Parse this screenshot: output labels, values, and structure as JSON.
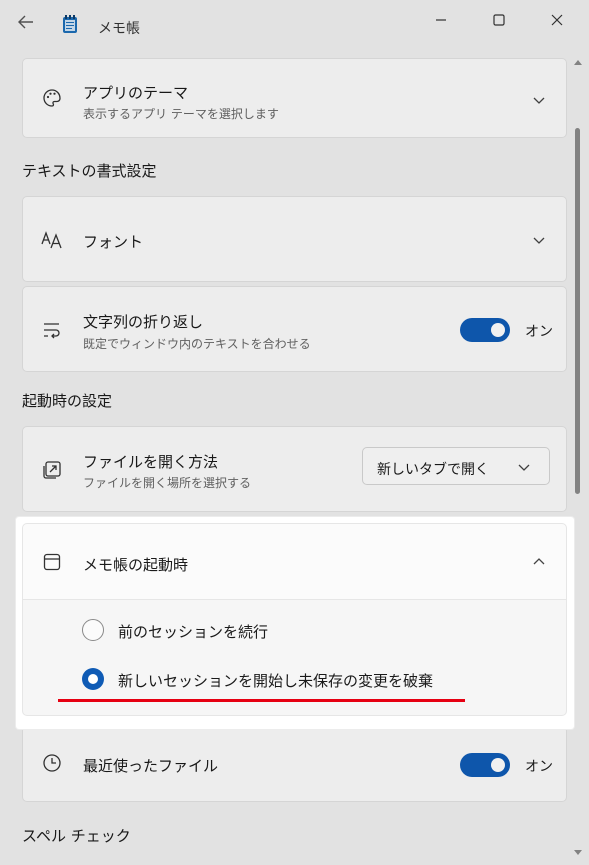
{
  "window": {
    "title": "メモ帳",
    "back_icon": "arrow-left-icon",
    "app_icon": "notepad-icon",
    "controls": [
      "minimize-icon",
      "maximize-icon",
      "close-icon"
    ]
  },
  "settings": {
    "app_theme": {
      "title": "アプリのテーマ",
      "description": "表示するアプリ テーマを選択します",
      "icon": "palette-icon"
    },
    "text_format_section": "テキストの書式設定",
    "font": {
      "title": "フォント",
      "icon": "font-icon"
    },
    "word_wrap": {
      "title": "文字列の折り返し",
      "description": "既定でウィンドウ内のテキストを合わせる",
      "toggle_label": "オン",
      "state": true,
      "icon": "wrap-icon"
    },
    "startup_section": "起動時の設定",
    "open_files": {
      "title": "ファイルを開く方法",
      "description": "ファイルを開く場所を選択する",
      "selected": "新しいタブで開く",
      "icon": "open-file-icon"
    },
    "startup": {
      "title": "メモ帳の起動時",
      "icon": "window-icon",
      "expanded": true,
      "options": [
        {
          "label": "前のセッションを続行",
          "selected": false
        },
        {
          "label": "新しいセッションを開始し未保存の変更を破棄",
          "selected": true
        }
      ]
    },
    "recent_files": {
      "title": "最近使ったファイル",
      "toggle_label": "オン",
      "state": true,
      "icon": "clock-icon"
    },
    "spellcheck_section": "スペル チェック"
  },
  "colors": {
    "accent": "#0f5bb5",
    "annotation": "#e60012"
  }
}
